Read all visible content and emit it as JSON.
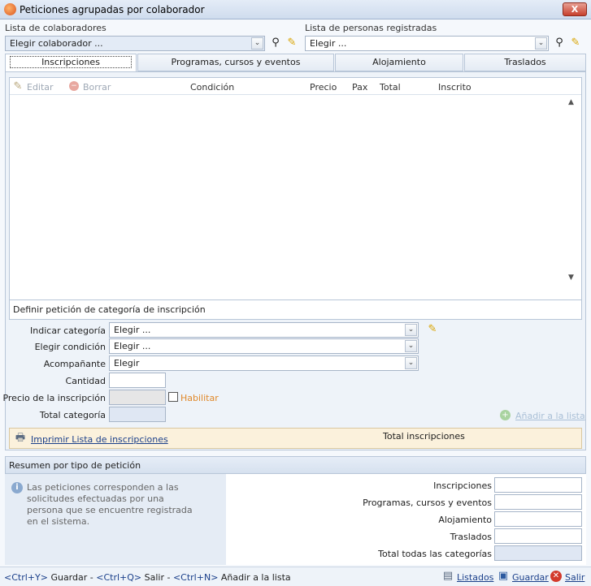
{
  "window": {
    "title": "Peticiones agrupadas por colaborador",
    "close_label": "X"
  },
  "collab": {
    "label": "Lista de colaboradores",
    "value": "Elegir colaborador ..."
  },
  "persons": {
    "label": "Lista de personas registradas",
    "value": "Elegir ..."
  },
  "tabs": [
    {
      "label": "Inscripciones"
    },
    {
      "label": "Programas, cursos y eventos"
    },
    {
      "label": "Alojamiento"
    },
    {
      "label": "Traslados"
    }
  ],
  "grid": {
    "edit_label": "Editar",
    "delete_label": "Borrar",
    "headers": [
      "Condición",
      "Precio",
      "Pax",
      "Total",
      "Inscrito"
    ]
  },
  "define": {
    "title": "Definir petición de categoría de inscripción",
    "category": {
      "label": "Indicar categoría",
      "value": "Elegir ..."
    },
    "condition": {
      "label": "Elegir condición",
      "value": "Elegir ..."
    },
    "companion": {
      "label": "Acompañante",
      "value": "Elegir"
    },
    "quantity_label": "Cantidad",
    "price_label": "Precio de la inscripción",
    "enable_label": "Habilitar",
    "total_cat_label": "Total categoría",
    "add_label": "Añadir a la lista"
  },
  "print_bar": {
    "print_label": "Imprimir Lista de inscripciones",
    "total_label": "Total inscripciones"
  },
  "summary": {
    "title": "Resumen por tipo de petición",
    "info": "Las peticiones corresponden a las solicitudes efectuadas por una persona que se encuentre registrada en el sistema.",
    "rows": [
      "Inscripciones",
      "Programas, cursos y eventos",
      "Alojamiento",
      "Traslados",
      "Total todas las categorías"
    ]
  },
  "footer": {
    "k1": "<Ctrl+Y>",
    "t1": " Guardar - ",
    "k2": "<Ctrl+Q>",
    "t2": " Salir - ",
    "k3": "<Ctrl+N>",
    "t3": " Añadir a la lista",
    "listados": "Listados",
    "guardar": "Guardar",
    "salir": "Salir"
  },
  "colors": {
    "accent": "#1a3f8a",
    "enable_orange": "#e0892b",
    "print_bar_bg": "#fbf1dc"
  }
}
